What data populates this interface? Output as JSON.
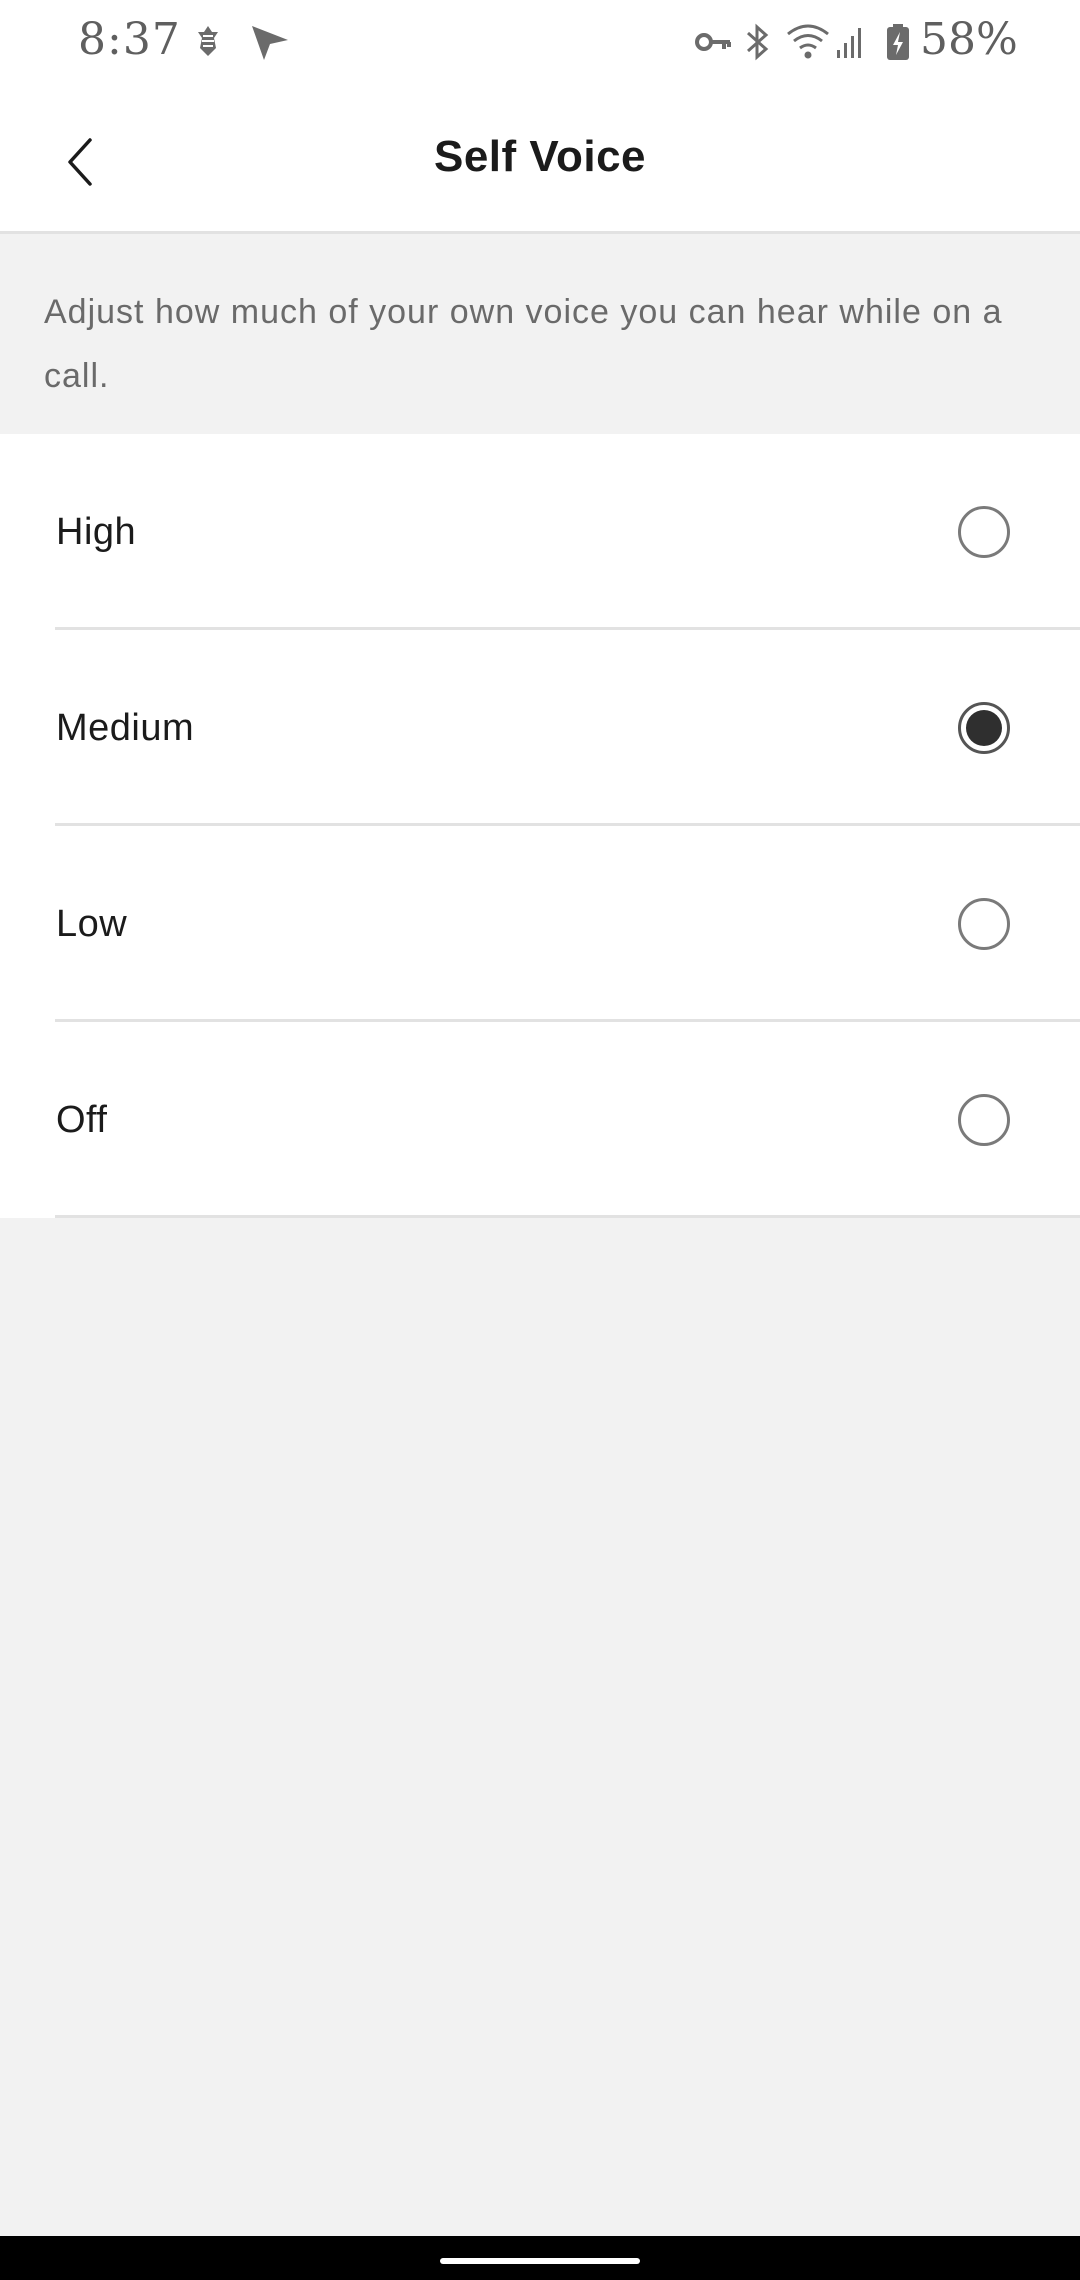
{
  "status_bar": {
    "time": "8:37",
    "battery": "58%",
    "left_icons": [
      "app-notification-icon",
      "location-arrow-icon"
    ],
    "right_icons": [
      "vpn-key-icon",
      "bluetooth-icon",
      "wifi-icon",
      "signal-icon",
      "battery-charging-icon"
    ]
  },
  "header": {
    "title": "Self Voice",
    "back_icon": "chevron-left-icon"
  },
  "description": "Adjust how much of your own voice you can hear while on a call.",
  "options": [
    {
      "label": "High",
      "selected": false
    },
    {
      "label": "Medium",
      "selected": true
    },
    {
      "label": "Low",
      "selected": false
    },
    {
      "label": "Off",
      "selected": false
    }
  ],
  "colors": {
    "background": "#f2f2f2",
    "surface": "#ffffff",
    "text": "#1b1b1b",
    "secondary_text": "#6a6a6a",
    "radio_selected": "#2f2f2f"
  }
}
